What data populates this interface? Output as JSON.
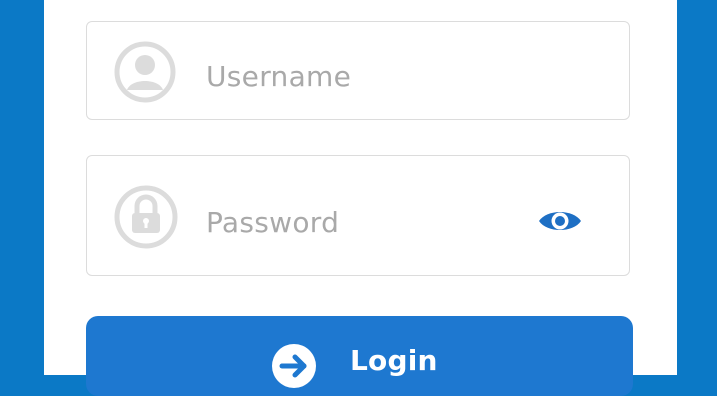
{
  "form": {
    "username_placeholder": "Username",
    "password_placeholder": "Password",
    "login_label": "Login",
    "icons": {
      "username": "user-circle-icon",
      "password": "padlock-icon",
      "reveal": "eye-icon",
      "login": "arrow-right-circle-icon"
    }
  },
  "colors": {
    "background": "#0b79c6",
    "panel": "#ffffff",
    "field_border": "#dcdcdc",
    "placeholder": "#a9a9a9",
    "icon_gray": "#dcdcdc",
    "eye_blue": "#1e6fc4",
    "button": "#1e78d0",
    "button_text": "#ffffff"
  }
}
